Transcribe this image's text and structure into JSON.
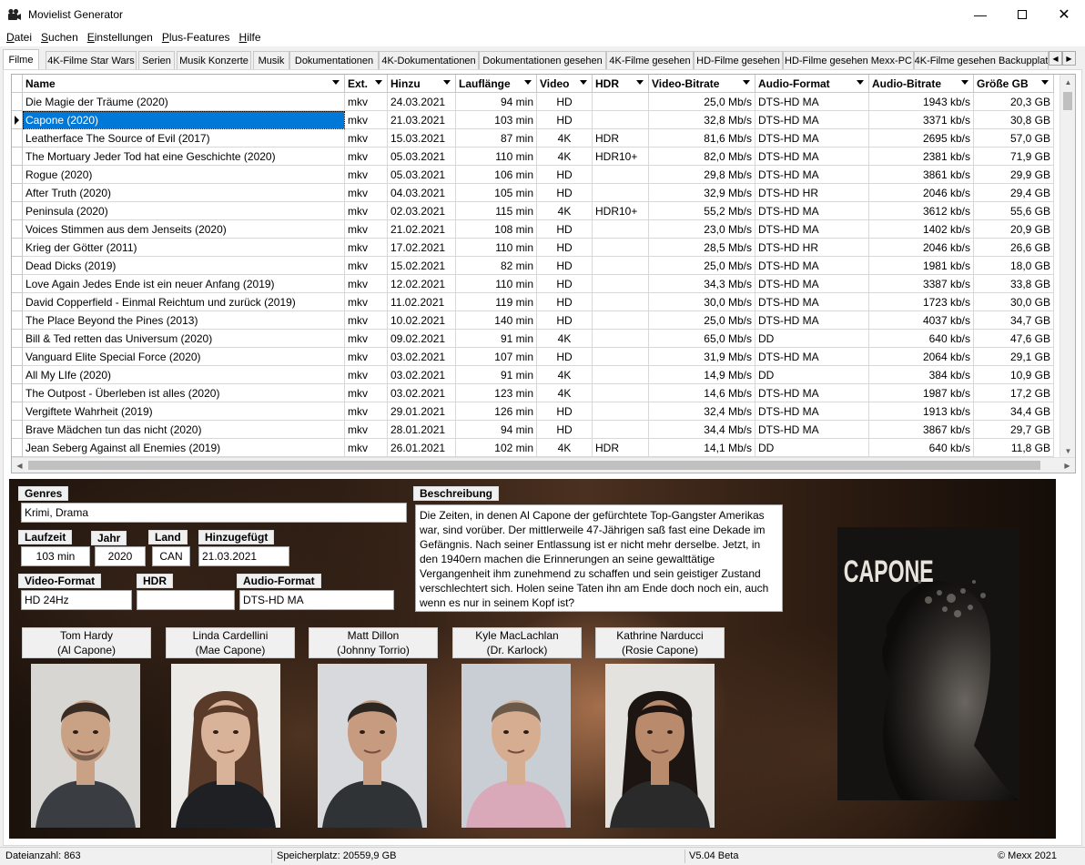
{
  "window": {
    "title": "Movielist Generator",
    "icon": "film-camera-icon"
  },
  "menu": [
    {
      "label": "Datei",
      "accel": "D"
    },
    {
      "label": "Suchen",
      "accel": "S"
    },
    {
      "label": "Einstellungen",
      "accel": "E"
    },
    {
      "label": "Plus-Features",
      "accel": "P"
    },
    {
      "label": "Hilfe",
      "accel": "H"
    }
  ],
  "tabs": [
    {
      "label": "Filme",
      "active": true
    },
    {
      "label": "4K-Filme Star Wars"
    },
    {
      "label": "Serien"
    },
    {
      "label": "Musik Konzerte"
    },
    {
      "label": "Musik"
    },
    {
      "label": "Dokumentationen"
    },
    {
      "label": "4K-Dokumentationen"
    },
    {
      "label": "Dokumentationen gesehen"
    },
    {
      "label": "4K-Filme gesehen"
    },
    {
      "label": "HD-Filme gesehen"
    },
    {
      "label": "HD-Filme gesehen Mexx-PC"
    },
    {
      "label": "4K-Filme gesehen Backupplat"
    }
  ],
  "table": {
    "columns": [
      "Name",
      "Ext.",
      "Hinzu",
      "Lauflänge",
      "Video",
      "HDR",
      "Video-Bitrate",
      "Audio-Format",
      "Audio-Bitrate",
      "Größe GB"
    ],
    "selected_index": 1,
    "rows": [
      [
        "Die Magie der Träume (2020)",
        "mkv",
        "24.03.2021",
        "94 min",
        "HD",
        "",
        "25,0 Mb/s",
        "DTS-HD MA",
        "1943 kb/s",
        "20,3 GB"
      ],
      [
        "Capone (2020)",
        "mkv",
        "21.03.2021",
        "103 min",
        "HD",
        "",
        "32,8 Mb/s",
        "DTS-HD MA",
        "3371 kb/s",
        "30,8 GB"
      ],
      [
        "Leatherface The Source of Evil (2017)",
        "mkv",
        "15.03.2021",
        "87 min",
        "4K",
        "HDR",
        "81,6 Mb/s",
        "DTS-HD MA",
        "2695 kb/s",
        "57,0 GB"
      ],
      [
        "The Mortuary Jeder Tod hat eine Geschichte (2020)",
        "mkv",
        "05.03.2021",
        "110 min",
        "4K",
        "HDR10+",
        "82,0 Mb/s",
        "DTS-HD MA",
        "2381 kb/s",
        "71,9 GB"
      ],
      [
        "Rogue (2020)",
        "mkv",
        "05.03.2021",
        "106 min",
        "HD",
        "",
        "29,8 Mb/s",
        "DTS-HD MA",
        "3861 kb/s",
        "29,9 GB"
      ],
      [
        "After Truth (2020)",
        "mkv",
        "04.03.2021",
        "105 min",
        "HD",
        "",
        "32,9 Mb/s",
        "DTS-HD HR",
        "2046 kb/s",
        "29,4 GB"
      ],
      [
        "Peninsula (2020)",
        "mkv",
        "02.03.2021",
        "115 min",
        "4K",
        "HDR10+",
        "55,2 Mb/s",
        "DTS-HD MA",
        "3612 kb/s",
        "55,6 GB"
      ],
      [
        "Voices Stimmen aus dem Jenseits (2020)",
        "mkv",
        "21.02.2021",
        "108 min",
        "HD",
        "",
        "23,0 Mb/s",
        "DTS-HD MA",
        "1402 kb/s",
        "20,9 GB"
      ],
      [
        "Krieg der Götter (2011)",
        "mkv",
        "17.02.2021",
        "110 min",
        "HD",
        "",
        "28,5 Mb/s",
        "DTS-HD HR",
        "2046 kb/s",
        "26,6 GB"
      ],
      [
        "Dead Dicks (2019)",
        "mkv",
        "15.02.2021",
        "82 min",
        "HD",
        "",
        "25,0 Mb/s",
        "DTS-HD MA",
        "1981 kb/s",
        "18,0 GB"
      ],
      [
        "Love Again Jedes Ende ist ein neuer Anfang (2019)",
        "mkv",
        "12.02.2021",
        "110 min",
        "HD",
        "",
        "34,3 Mb/s",
        "DTS-HD MA",
        "3387 kb/s",
        "33,8 GB"
      ],
      [
        "David Copperfield - Einmal Reichtum und zurück (2019)",
        "mkv",
        "11.02.2021",
        "119 min",
        "HD",
        "",
        "30,0 Mb/s",
        "DTS-HD MA",
        "1723 kb/s",
        "30,0 GB"
      ],
      [
        "The Place Beyond the Pines (2013)",
        "mkv",
        "10.02.2021",
        "140 min",
        "HD",
        "",
        "25,0 Mb/s",
        "DTS-HD MA",
        "4037 kb/s",
        "34,7 GB"
      ],
      [
        "Bill & Ted retten das Universum (2020)",
        "mkv",
        "09.02.2021",
        "91 min",
        "4K",
        "",
        "65,0 Mb/s",
        "DD",
        "640 kb/s",
        "47,6 GB"
      ],
      [
        "Vanguard Elite Special Force (2020)",
        "mkv",
        "03.02.2021",
        "107 min",
        "HD",
        "",
        "31,9 Mb/s",
        "DTS-HD MA",
        "2064 kb/s",
        "29,1 GB"
      ],
      [
        "All My LIfe (2020)",
        "mkv",
        "03.02.2021",
        "91 min",
        "4K",
        "",
        "14,9 Mb/s",
        "DD",
        "384 kb/s",
        "10,9 GB"
      ],
      [
        "The Outpost - Überleben ist alles (2020)",
        "mkv",
        "03.02.2021",
        "123 min",
        "4K",
        "",
        "14,6 Mb/s",
        "DTS-HD MA",
        "1987 kb/s",
        "17,2 GB"
      ],
      [
        "Vergiftete Wahrheit (2019)",
        "mkv",
        "29.01.2021",
        "126 min",
        "HD",
        "",
        "32,4 Mb/s",
        "DTS-HD MA",
        "1913 kb/s",
        "34,4 GB"
      ],
      [
        "Brave Mädchen tun das nicht (2020)",
        "mkv",
        "28.01.2021",
        "94 min",
        "HD",
        "",
        "34,4 Mb/s",
        "DTS-HD MA",
        "3867 kb/s",
        "29,7 GB"
      ],
      [
        "Jean Seberg Against all Enemies (2019)",
        "mkv",
        "26.01.2021",
        "102 min",
        "4K",
        "HDR",
        "14,1 Mb/s",
        "DD",
        "640 kb/s",
        "11,8 GB"
      ]
    ]
  },
  "detail": {
    "genres_label": "Genres",
    "genres": "Krimi, Drama",
    "laufzeit_label": "Laufzeit",
    "laufzeit": "103 min",
    "jahr_label": "Jahr",
    "jahr": "2020",
    "land_label": "Land",
    "land": "CAN",
    "hinzugefuegt_label": "Hinzugefügt",
    "hinzugefuegt": "21.03.2021",
    "video_format_label": "Video-Format",
    "video_format": "HD 24Hz",
    "hdr_label": "HDR",
    "hdr": "",
    "audio_format_label": "Audio-Format",
    "audio_format": "DTS-HD MA",
    "beschreibung_label": "Beschreibung",
    "beschreibung": "Die Zeiten, in denen Al Capone der gefürchtete Top-Gangster Amerikas war, sind vorüber. Der mittlerweile 47-Jährigen saß fast eine Dekade im Gefängnis. Nach seiner Entlassung ist er nicht mehr derselbe. Jetzt, in den 1940ern machen die Erinnerungen an seine gewalttätige Vergangenheit ihm zunehmend zu schaffen und sein geistiger Zustand verschlechtert sich. Holen seine Taten ihn am Ende doch noch ein, auch wenn es nur in seinem Kopf ist?",
    "poster_title": "CAPONE",
    "cast": [
      {
        "actor": "Tom Hardy",
        "role": "(Al Capone)"
      },
      {
        "actor": "Linda Cardellini",
        "role": "(Mae Capone)"
      },
      {
        "actor": "Matt Dillon",
        "role": "(Johnny Torrio)"
      },
      {
        "actor": "Kyle MacLachlan",
        "role": "(Dr. Karlock)"
      },
      {
        "actor": "Kathrine Narducci",
        "role": "(Rosie Capone)"
      }
    ]
  },
  "status": {
    "count": "Dateianzahl: 863",
    "storage": "Speicherplatz: 20559,9 GB",
    "version": "V5.04 Beta",
    "copyright": "© Mexx 2021"
  }
}
